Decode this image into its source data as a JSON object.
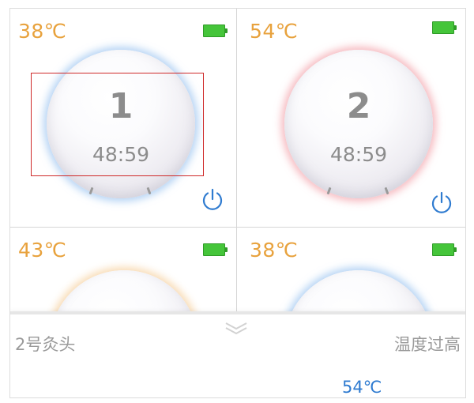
{
  "cells": [
    {
      "temp": "38℃",
      "number": "1",
      "time": "48:59",
      "glow": "#78afeb"
    },
    {
      "temp": "54℃",
      "number": "2",
      "time": "48:59",
      "glow": "#f08c96"
    },
    {
      "temp": "43℃",
      "glow": "#f5c88c"
    },
    {
      "temp": "38℃",
      "glow": "#78afeb"
    }
  ],
  "colors": {
    "temperature": "#e8a23d",
    "battery": "#45c53a",
    "power_icon": "#2f7bd0",
    "selection": "#cf2a2a",
    "muted_text": "#9a9a9a"
  },
  "icons": {
    "battery": "battery-full-icon",
    "power": "power-icon",
    "chevron": "double-chevron-down-icon"
  },
  "drawer": {
    "left_label": "2号灸头",
    "right_label": "温度过高",
    "temp_value": "54℃"
  }
}
